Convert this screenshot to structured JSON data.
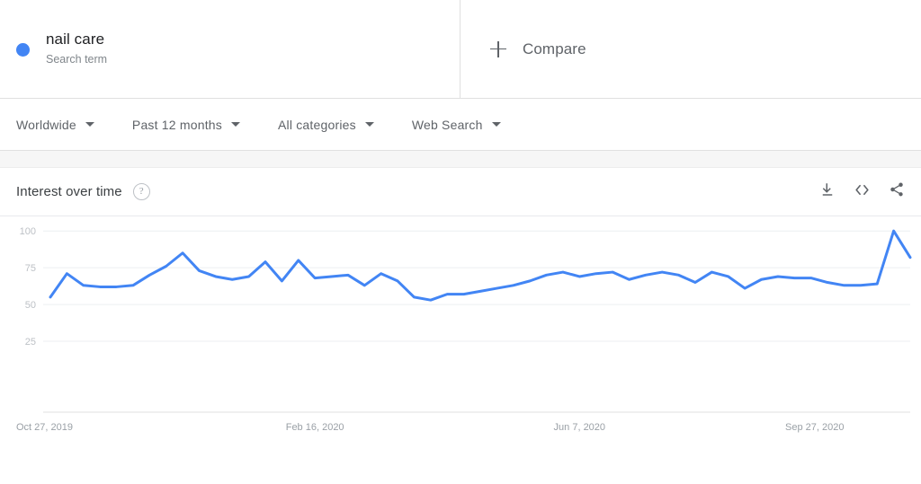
{
  "terms": [
    {
      "name": "nail care",
      "type_label": "Search term",
      "dot_color": "#4285F4"
    }
  ],
  "compare": {
    "label": "Compare",
    "icon": "plus-icon"
  },
  "filters": [
    {
      "label": "Worldwide",
      "icon": "chevron-down-icon"
    },
    {
      "label": "Past 12 months",
      "icon": "chevron-down-icon"
    },
    {
      "label": "All categories",
      "icon": "chevron-down-icon"
    },
    {
      "label": "Web Search",
      "icon": "chevron-down-icon"
    }
  ],
  "card": {
    "title": "Interest over time",
    "help_icon": "?",
    "actions": [
      {
        "name": "download-icon"
      },
      {
        "name": "embed-icon"
      },
      {
        "name": "share-icon"
      }
    ]
  },
  "chart_data": {
    "type": "line",
    "title": "Interest over time",
    "xlabel": "",
    "ylabel": "",
    "ylim": [
      0,
      105
    ],
    "yticks": [
      25,
      50,
      75,
      100
    ],
    "grid": true,
    "legend": false,
    "line_color": "#4285F4",
    "series_name": "nail care",
    "x_tick_labels": [
      "Oct 27, 2019",
      "Feb 16, 2020",
      "Jun 7, 2020",
      "Sep 27, 2020"
    ],
    "x_tick_indices": [
      0,
      16,
      32,
      48
    ],
    "x": [
      "Oct 27, 2019",
      "Nov 3, 2019",
      "Nov 10, 2019",
      "Nov 17, 2019",
      "Nov 24, 2019",
      "Dec 1, 2019",
      "Dec 8, 2019",
      "Dec 15, 2019",
      "Dec 22, 2019",
      "Dec 29, 2019",
      "Jan 5, 2020",
      "Jan 12, 2020",
      "Jan 19, 2020",
      "Jan 26, 2020",
      "Feb 2, 2020",
      "Feb 9, 2020",
      "Feb 16, 2020",
      "Feb 23, 2020",
      "Mar 1, 2020",
      "Mar 8, 2020",
      "Mar 15, 2020",
      "Mar 22, 2020",
      "Mar 29, 2020",
      "Apr 5, 2020",
      "Apr 12, 2020",
      "Apr 19, 2020",
      "Apr 26, 2020",
      "May 3, 2020",
      "May 10, 2020",
      "May 17, 2020",
      "May 24, 2020",
      "May 31, 2020",
      "Jun 7, 2020",
      "Jun 14, 2020",
      "Jun 21, 2020",
      "Jun 28, 2020",
      "Jul 5, 2020",
      "Jul 12, 2020",
      "Jul 19, 2020",
      "Jul 26, 2020",
      "Aug 2, 2020",
      "Aug 9, 2020",
      "Aug 16, 2020",
      "Aug 23, 2020",
      "Aug 30, 2020",
      "Sep 6, 2020",
      "Sep 13, 2020",
      "Sep 20, 2020",
      "Sep 27, 2020",
      "Oct 4, 2020",
      "Oct 11, 2020",
      "Oct 18, 2020"
    ],
    "values": [
      55,
      71,
      63,
      62,
      62,
      63,
      70,
      76,
      85,
      73,
      69,
      67,
      69,
      79,
      66,
      80,
      68,
      69,
      70,
      63,
      71,
      66,
      55,
      53,
      57,
      57,
      59,
      61,
      63,
      66,
      70,
      72,
      69,
      71,
      72,
      67,
      70,
      72,
      70,
      65,
      72,
      69,
      61,
      67,
      69,
      68,
      68,
      65,
      63,
      63,
      64,
      100,
      82
    ]
  }
}
